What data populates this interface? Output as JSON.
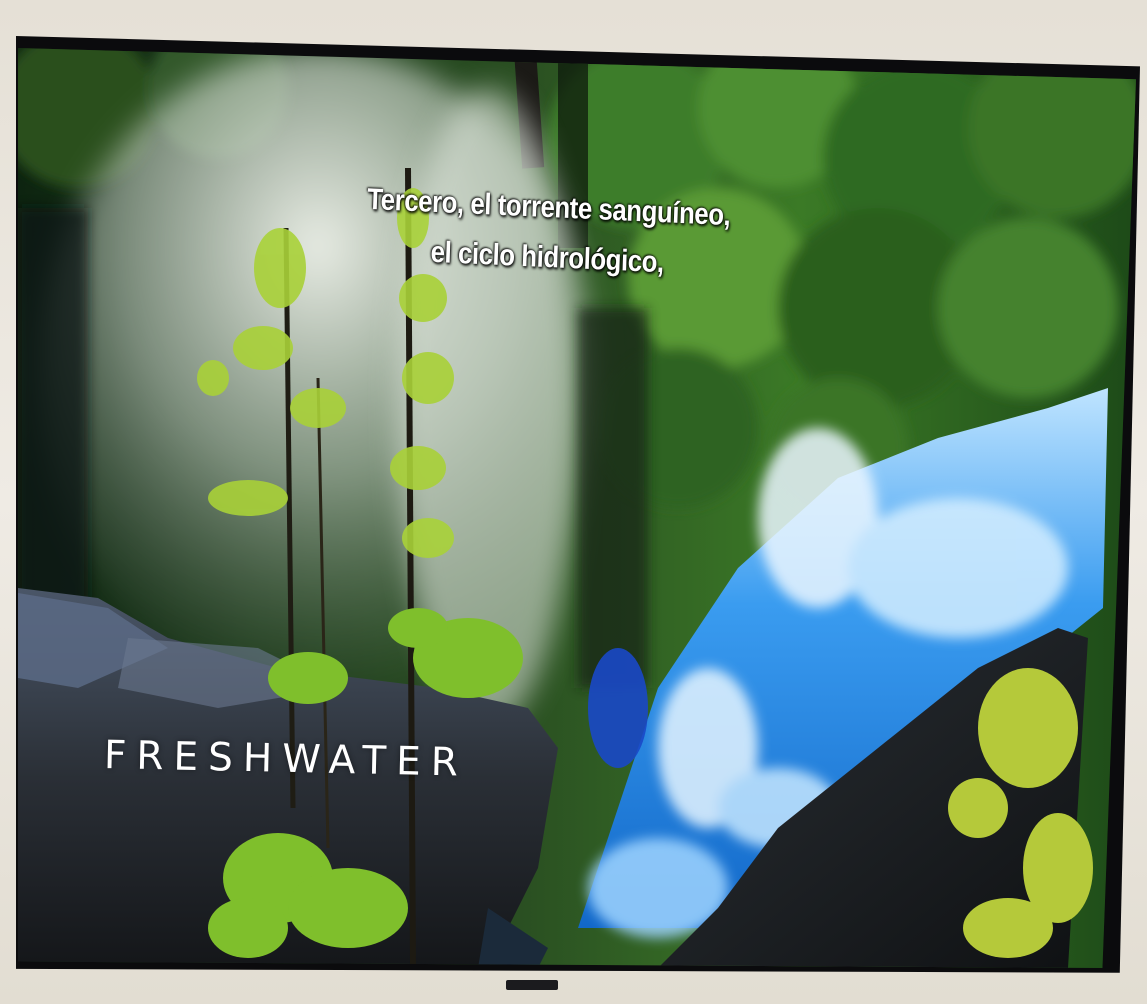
{
  "subtitle": {
    "line1": "Tercero, el torrente sanguíneo,",
    "line2": "el ciclo hidrológico,"
  },
  "title_card": "FRESHWATER",
  "colors": {
    "wall": "#e9e4dc",
    "bezel": "#0b0b0d",
    "water": "#2f8fe6",
    "foliage": "#1f5a1c"
  }
}
